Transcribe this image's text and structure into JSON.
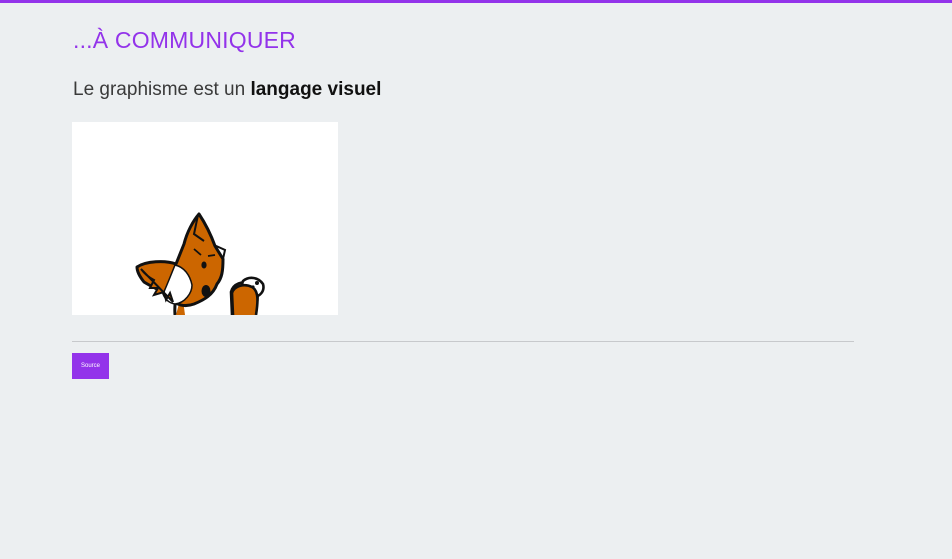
{
  "section": {
    "title": "...À COMMUNIQUER"
  },
  "lead": {
    "prefix": "Le graphisme est un ",
    "emphasis": "langage visuel"
  },
  "illustration": {
    "subject": "cartoon fox"
  },
  "source_button": {
    "label": "Source"
  },
  "colors": {
    "accent": "#9333ea",
    "background": "#eceff1",
    "fox": "#cc6600"
  }
}
